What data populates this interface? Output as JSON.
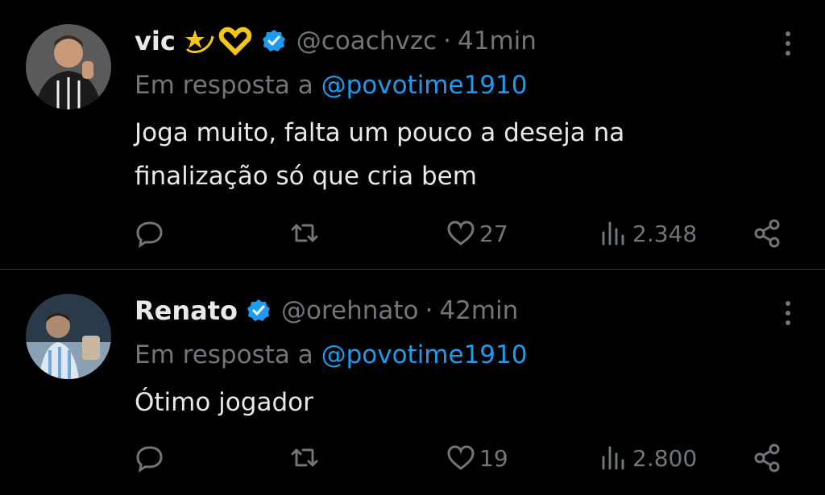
{
  "tweets": [
    {
      "name": "vic",
      "emoji": "💫🫶",
      "handle": "@coachvzc",
      "sep": "·",
      "time": "41min",
      "reply_prefix": "Em resposta a ",
      "reply_to": "@povotime1910",
      "text_lines": [
        "Joga muito, falta um pouco a deseja na",
        "finalização só que cria bem"
      ],
      "likes": "27",
      "views": "2.348"
    },
    {
      "name": "Renato",
      "handle": "@orehnato",
      "sep": "·",
      "time": "42min",
      "reply_prefix": "Em resposta a ",
      "reply_to": "@povotime1910",
      "text_lines": [
        "Ótimo jogador"
      ],
      "likes": "19",
      "views": "2.800"
    }
  ],
  "colors": {
    "background": "#000000",
    "text": "#e7e9ea",
    "muted": "#71767b",
    "link": "#1d9bf0",
    "verified": "#1d9bf0"
  },
  "icons": [
    "reply-icon",
    "retweet-icon",
    "like-icon",
    "views-icon",
    "share-icon",
    "more-icon",
    "verified-badge-icon"
  ]
}
